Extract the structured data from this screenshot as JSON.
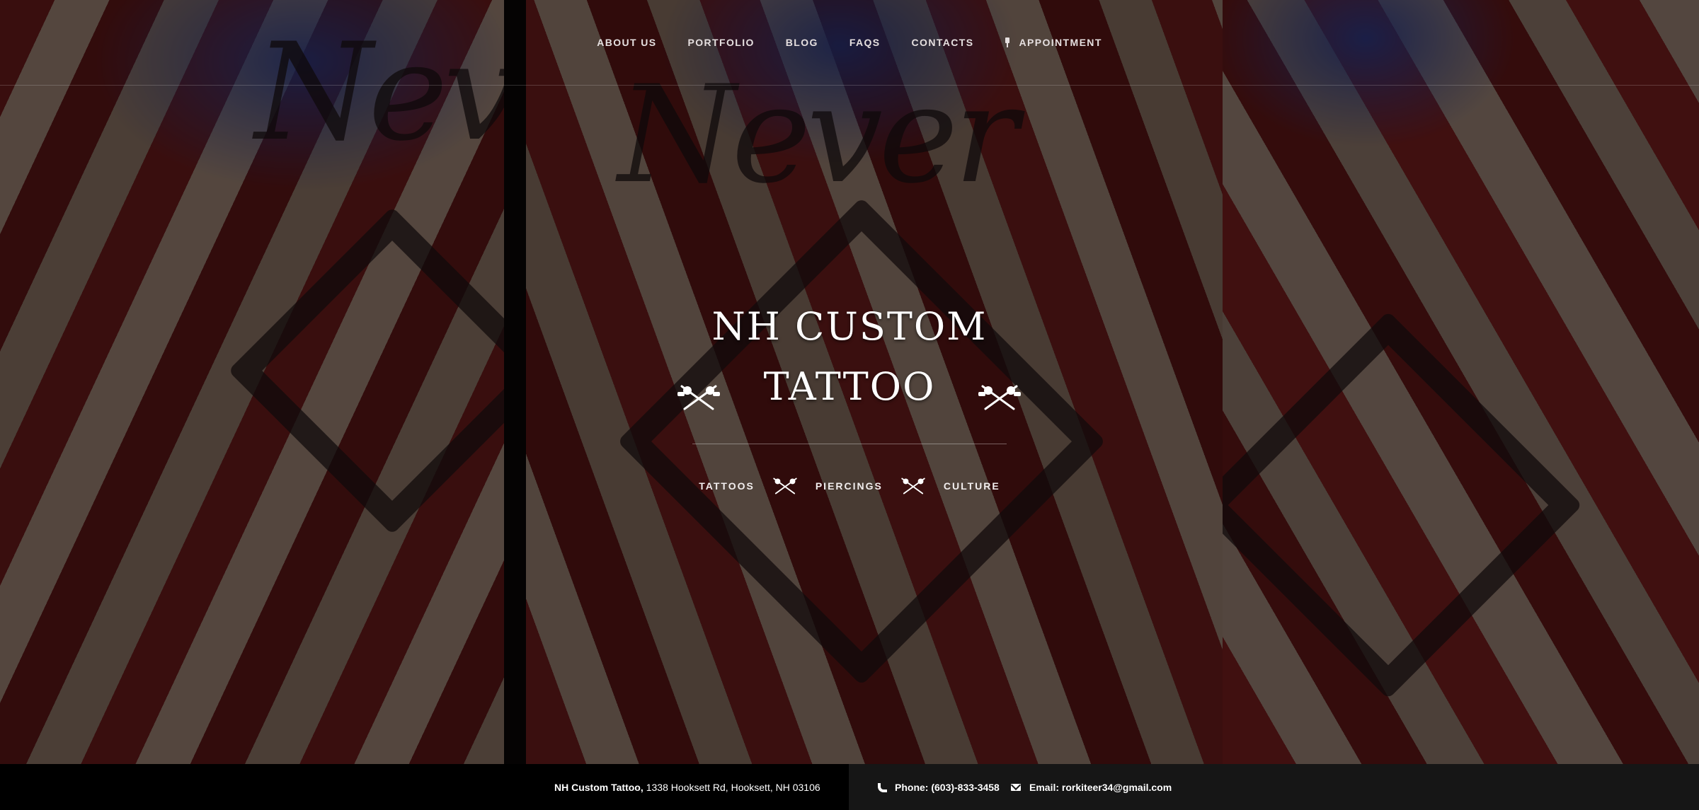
{
  "nav": {
    "items": [
      {
        "label": "ABOUT US"
      },
      {
        "label": "PORTFOLIO"
      },
      {
        "label": "BLOG"
      },
      {
        "label": "FAQS"
      },
      {
        "label": "CONTACTS"
      },
      {
        "label": "APPOINTMENT",
        "icon": "pin-icon"
      }
    ]
  },
  "brand": {
    "line1": "NH CUSTOM",
    "line2": "TATTOO"
  },
  "tagline": [
    "TATTOOS",
    "PIERCINGS",
    "CULTURE"
  ],
  "footer": {
    "business_name": "NH Custom Tattoo,",
    "address": "1338 Hooksett Rd, Hooksett, NH 03106",
    "phone_label": "Phone: (603)-833-3458",
    "email_label": "Email: rorkiteer34@gmail.com"
  },
  "colors": {
    "footer_left": "#000000",
    "footer_right": "#161616",
    "text": "#ffffff"
  }
}
